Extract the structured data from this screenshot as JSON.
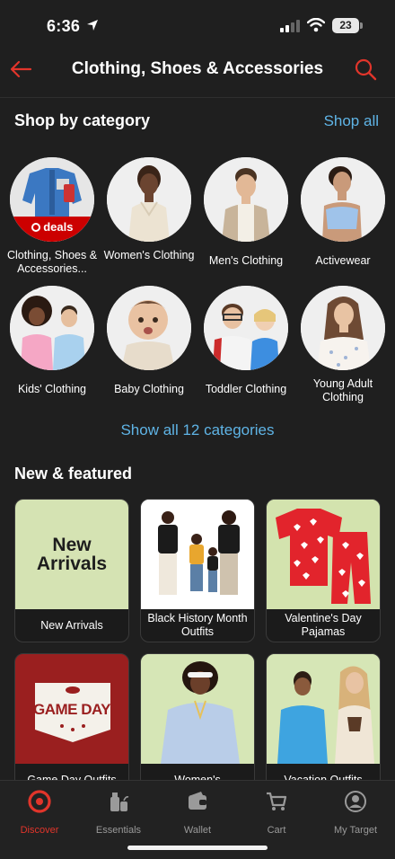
{
  "status_bar": {
    "time": "6:36",
    "battery": "23"
  },
  "header": {
    "title": "Clothing, Shoes & Accessories"
  },
  "colors": {
    "accent": "#e1352b",
    "link": "#5fb4e6",
    "background": "#1f1f1f"
  },
  "shop_by_category": {
    "title": "Shop by category",
    "shop_all": "Shop all",
    "items": [
      {
        "label": "Clothing, Shoes & Accessories...",
        "badge": "deals"
      },
      {
        "label": "Women's Clothing"
      },
      {
        "label": "Men's Clothing"
      },
      {
        "label": "Activewear"
      },
      {
        "label": "Kids' Clothing"
      },
      {
        "label": "Baby Clothing"
      },
      {
        "label": "Toddler Clothing"
      },
      {
        "label": "Young Adult Clothing"
      }
    ],
    "show_all": "Show all 12 categories"
  },
  "new_featured": {
    "title": "New & featured",
    "cards": [
      {
        "label": "New Arrivals",
        "image_text": "New Arrivals"
      },
      {
        "label": "Black History Month Outfits"
      },
      {
        "label": "Valentine's Day Pajamas"
      },
      {
        "label": "Game Day Outfits",
        "image_text": "GAME DAY"
      },
      {
        "label": "Women's"
      },
      {
        "label": "Vacation Outfits"
      }
    ]
  },
  "bottom_nav": [
    {
      "label": "Discover",
      "icon": "target-bullseye-icon"
    },
    {
      "label": "Essentials",
      "icon": "essentials-icon"
    },
    {
      "label": "Wallet",
      "icon": "wallet-icon"
    },
    {
      "label": "Cart",
      "icon": "cart-icon"
    },
    {
      "label": "My Target",
      "icon": "profile-icon"
    }
  ]
}
